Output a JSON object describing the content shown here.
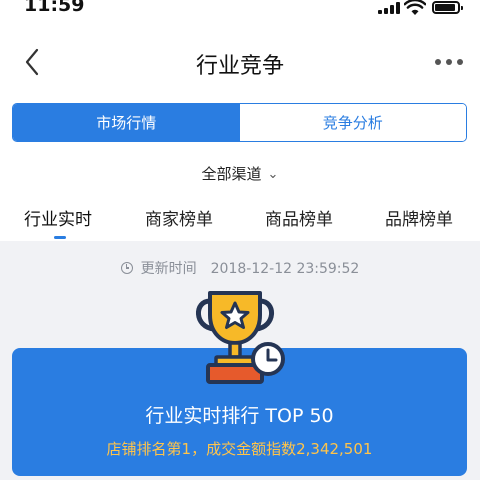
{
  "status_bar": {
    "time": "11:59",
    "battery_level": 0.85
  },
  "nav": {
    "title": "行业竞争",
    "back_icon": "chevron-left-icon",
    "more_icon": "more-horizontal-icon"
  },
  "segment": {
    "tabs": [
      {
        "label": "市场行情",
        "active": true
      },
      {
        "label": "竞争分析",
        "active": false
      }
    ]
  },
  "channel": {
    "label": "全部渠道",
    "icon": "chevron-down-icon"
  },
  "tabs": [
    {
      "label": "行业实时",
      "active": true
    },
    {
      "label": "商家榜单"
    },
    {
      "label": "商品榜单"
    },
    {
      "label": "品牌榜单"
    }
  ],
  "update": {
    "label": "更新时间",
    "time": "2018-12-12 23:59:52",
    "icon": "clock-icon"
  },
  "card": {
    "title": "行业实时排行 TOP 50",
    "subtitle": "店铺排名第1，成交金额指数2,342,501",
    "icon": "trophy-icon"
  },
  "colors": {
    "accent": "#2a7de1",
    "highlight": "#ffc44a",
    "background_muted": "#f1f2f5"
  }
}
